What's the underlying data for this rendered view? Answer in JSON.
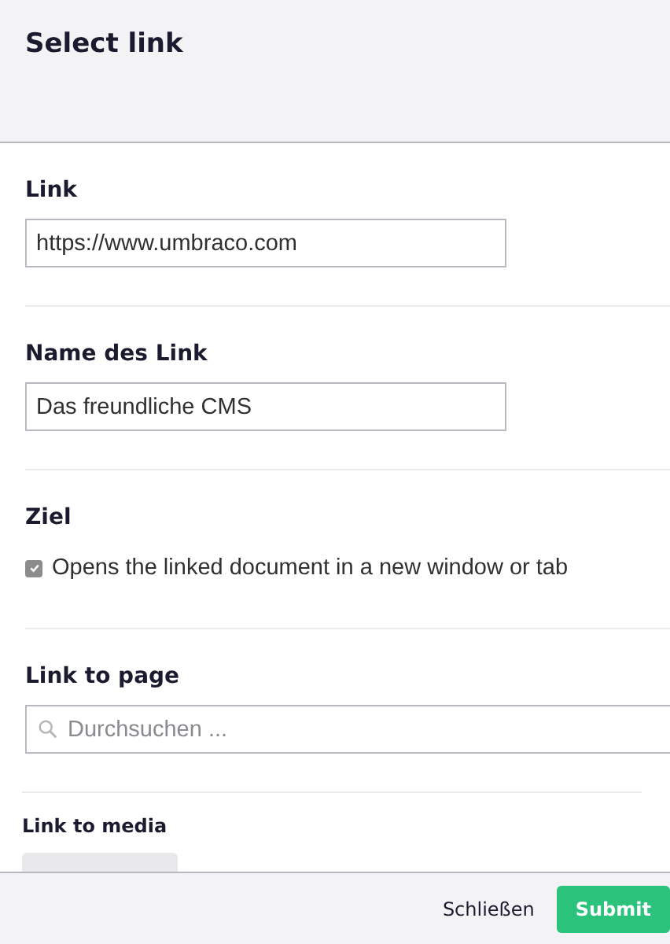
{
  "dialog": {
    "title": "Select link"
  },
  "link": {
    "label": "Link",
    "value": "https://www.umbraco.com"
  },
  "name": {
    "label": "Name des Link",
    "value": "Das freundliche CMS"
  },
  "target": {
    "label": "Ziel",
    "checked": true,
    "text": "Opens the linked document in a new window or tab"
  },
  "link_to_page": {
    "label": "Link to page",
    "placeholder": "Durchsuchen ..."
  },
  "link_to_media": {
    "label": "Link to media"
  },
  "buttons": [
    {
      "kind": "secondary",
      "label": "Schließen"
    },
    {
      "kind": "primary",
      "label": "Submit"
    }
  ]
}
